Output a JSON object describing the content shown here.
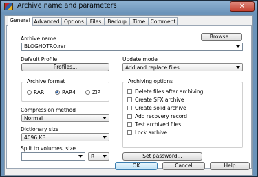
{
  "window": {
    "title": "Archive name and parameters",
    "close_glyph": "✕",
    "app_icon": "winrar-books-icon"
  },
  "tabs": [
    {
      "label": "General",
      "active": true
    },
    {
      "label": "Advanced"
    },
    {
      "label": "Options"
    },
    {
      "label": "Files"
    },
    {
      "label": "Backup"
    },
    {
      "label": "Time"
    },
    {
      "label": "Comment"
    }
  ],
  "archive_name": {
    "label": "Archive name",
    "value": "BLOGHOTRO.rar",
    "browse_label": "Browse..."
  },
  "default_profile": {
    "label": "Default Profile",
    "profiles_label": "Profiles..."
  },
  "update_mode": {
    "label": "Update mode",
    "value": "Add and replace files"
  },
  "archive_format": {
    "label": "Archive format",
    "options": [
      {
        "label": "RAR",
        "selected": false
      },
      {
        "label": "RAR4",
        "selected": true
      },
      {
        "label": "ZIP",
        "selected": false
      }
    ]
  },
  "archiving_options": {
    "label": "Archiving options",
    "items": [
      {
        "label": "Delete files after archiving",
        "checked": false
      },
      {
        "label": "Create SFX archive",
        "checked": false
      },
      {
        "label": "Create solid archive",
        "checked": false
      },
      {
        "label": "Add recovery record",
        "checked": false
      },
      {
        "label": "Test archived files",
        "checked": false
      },
      {
        "label": "Lock archive",
        "checked": false
      }
    ]
  },
  "compression": {
    "label": "Compression method",
    "value": "Normal"
  },
  "dictionary": {
    "label": "Dictionary size",
    "value": "4096 KB"
  },
  "split": {
    "label": "Split to volumes, size",
    "value": "",
    "unit": "B"
  },
  "set_password_label": "Set password...",
  "buttons": {
    "ok": "OK",
    "cancel": "Cancel",
    "help": "Help"
  }
}
